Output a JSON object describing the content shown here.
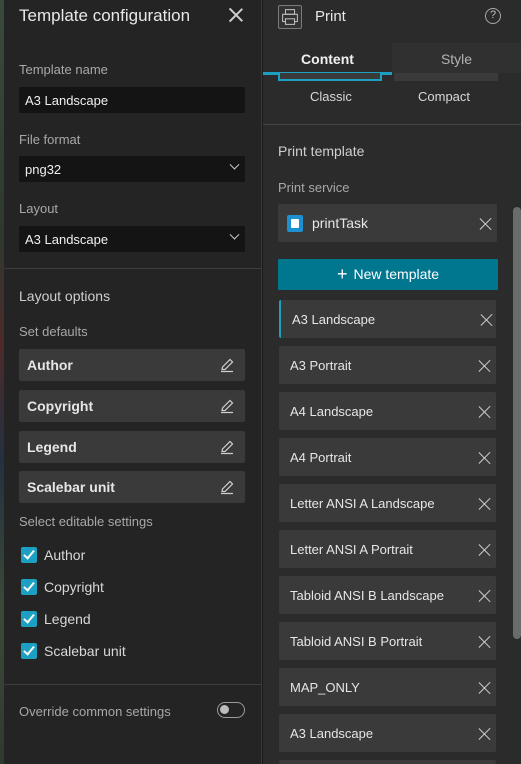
{
  "left_panel": {
    "title": "Template configuration",
    "template_name_label": "Template name",
    "template_name_value": "A3 Landscape",
    "file_format_label": "File format",
    "file_format_value": "png32",
    "layout_label": "Layout",
    "layout_value": "A3 Landscape",
    "layout_options_title": "Layout options",
    "set_defaults_label": "Set defaults",
    "defaults": [
      "Author",
      "Copyright",
      "Legend",
      "Scalebar unit"
    ],
    "select_editable_label": "Select editable settings",
    "editable_settings": [
      {
        "label": "Author",
        "checked": true
      },
      {
        "label": "Copyright",
        "checked": true
      },
      {
        "label": "Legend",
        "checked": true
      },
      {
        "label": "Scalebar unit",
        "checked": true
      }
    ],
    "override_label": "Override common settings",
    "override_on": false
  },
  "right_panel": {
    "title": "Print",
    "tabs": [
      "Content",
      "Style"
    ],
    "active_tab": "Content",
    "layout_styles": [
      "Classic",
      "Compact"
    ],
    "print_template_title": "Print template",
    "print_service_label": "Print service",
    "print_service_value": "printTask",
    "new_template_label": "New template",
    "templates": [
      "A3 Landscape",
      "A3 Portrait",
      "A4 Landscape",
      "A4 Portrait",
      "Letter ANSI A Landscape",
      "Letter ANSI A Portrait",
      "Tabloid ANSI B Landscape",
      "Tabloid ANSI B Portrait",
      "MAP_ONLY",
      "A3 Landscape"
    ],
    "selected_template_index": 0
  },
  "colors": {
    "accent": "#1c9fc0",
    "primary_button": "#00768f",
    "panel_bg": "#242424"
  }
}
